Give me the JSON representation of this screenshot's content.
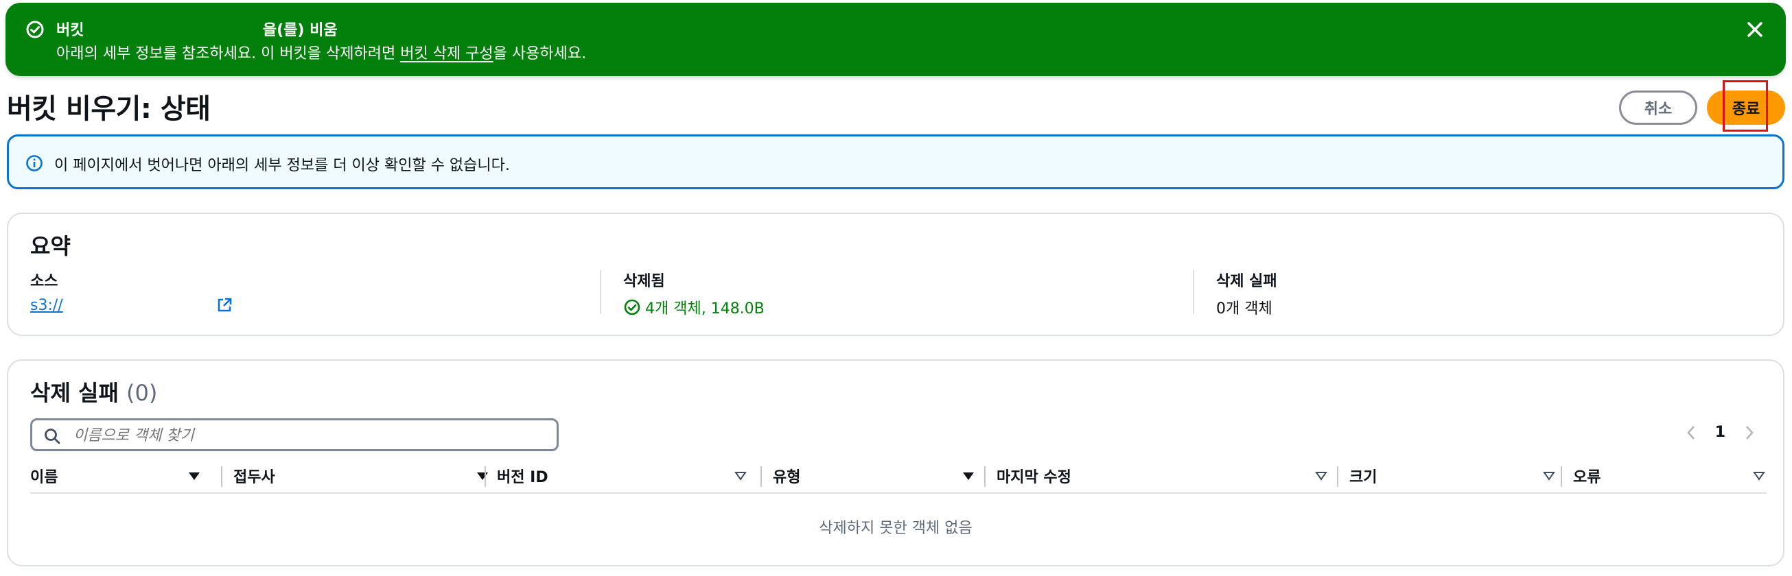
{
  "flash": {
    "title": "버킷                                  을(를) 비움",
    "message_pre": "아래의 세부 정보를 참조하세요. 이 버킷을 삭제하려면 ",
    "message_link": "버킷 삭제 구성",
    "message_post": "을 사용하세요.",
    "color": "#037f0c"
  },
  "page": {
    "title": "버킷 비우기: 상태",
    "cancel_label": "취소",
    "exit_label": "종료"
  },
  "info": {
    "text": "이 페이지에서 벗어나면 아래의 세부 정보를 더 이상 확인할 수 없습니다."
  },
  "summary": {
    "title": "요약",
    "source_label": "소스",
    "source_value": "s3://",
    "deleted_label": "삭제됨",
    "deleted_value": "4개 객체, 148.0B",
    "failed_label": "삭제 실패",
    "failed_value": "0개 객체"
  },
  "failures": {
    "title": "삭제 실패",
    "count": "(0)",
    "search_placeholder": "이름으로 객체 찾기",
    "page_number": "1",
    "columns": [
      "이름",
      "접두사",
      "버전 ID",
      "유형",
      "마지막 수정",
      "크기",
      "오류"
    ],
    "empty_text": "삭제하지 못한 객체 없음"
  }
}
